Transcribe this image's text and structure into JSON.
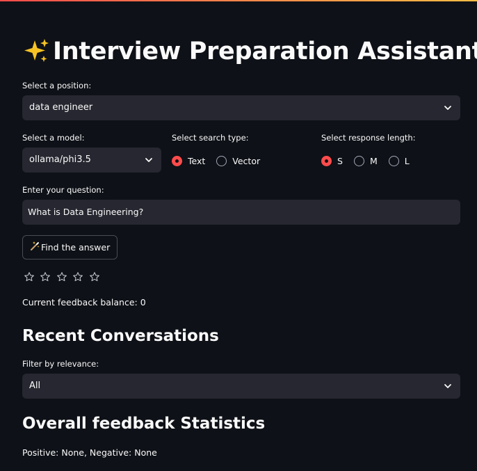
{
  "title": "Interview Preparation Assistant",
  "position": {
    "label": "Select a position:",
    "value": "data engineer"
  },
  "model": {
    "label": "Select a model:",
    "value": "ollama/phi3.5"
  },
  "search_type": {
    "label": "Select search type:",
    "options": [
      "Text",
      "Vector"
    ],
    "selected": "Text"
  },
  "response_length": {
    "label": "Select response length:",
    "options": [
      "S",
      "M",
      "L"
    ],
    "selected": "S"
  },
  "question": {
    "label": "Enter your question:",
    "value": "What is Data Engineering?"
  },
  "find_button": {
    "label": "Find the answer"
  },
  "rating": {
    "max": 5,
    "value": 0
  },
  "feedback_balance": "Current feedback balance: 0",
  "recent": {
    "heading": "Recent Conversations",
    "filter_label": "Filter by relevance:",
    "filter_value": "All"
  },
  "stats": {
    "heading": "Overall feedback Statistics",
    "summary": "Positive: None, Negative: None"
  },
  "colors": {
    "background": "#0e1117",
    "widget": "#262730",
    "accent": "#ff4b4b",
    "text": "#fafafa"
  }
}
